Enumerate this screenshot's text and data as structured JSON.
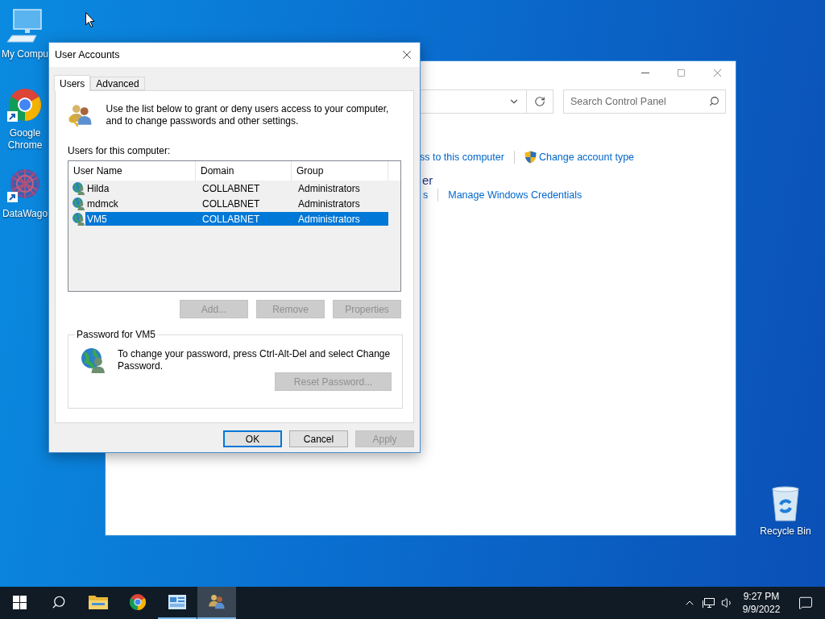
{
  "desktop_icons": [
    {
      "kind": "computer",
      "label": "My Compu"
    },
    {
      "kind": "chrome",
      "label": "Google Chrome"
    },
    {
      "kind": "datawagon",
      "label": "DataWago"
    },
    {
      "kind": "recycle",
      "label": "Recycle Bin"
    }
  ],
  "control_panel": {
    "search": {
      "placeholder": "Search Control Panel"
    },
    "links_row_1": [
      "ss to this computer",
      "Change account type"
    ],
    "heading": "er",
    "links_row_2": [
      "s",
      "Manage Windows Credentials"
    ]
  },
  "dialog": {
    "title": "User Accounts",
    "tabs": [
      {
        "label": "Users",
        "selected": true
      },
      {
        "label": "Advanced",
        "selected": false
      }
    ],
    "intro": "Use the list below to grant or deny users access to your computer, and to change passwords and other settings.",
    "users_label": "Users for this computer:",
    "columns": [
      "User Name",
      "Domain",
      "Group"
    ],
    "rows": [
      {
        "cells": [
          "Hilda",
          "COLLABNET",
          "Administrators"
        ],
        "selected": false
      },
      {
        "cells": [
          "mdmck",
          "COLLABNET",
          "Administrators"
        ],
        "selected": false
      },
      {
        "cells": [
          "VM5",
          "COLLABNET",
          "Administrators"
        ],
        "selected": true
      }
    ],
    "list_buttons": [
      {
        "label": "Add...",
        "disabled": true
      },
      {
        "label": "Remove",
        "disabled": true
      },
      {
        "label": "Properties",
        "disabled": true
      }
    ],
    "password_group": {
      "title": "Password for VM5",
      "text": "To change your password, press Ctrl-Alt-Del and select Change Password.",
      "button": {
        "label": "Reset Password...",
        "disabled": true
      }
    },
    "footer_buttons": [
      {
        "label": "OK",
        "disabled": false,
        "default": true
      },
      {
        "label": "Cancel",
        "disabled": false,
        "default": false
      },
      {
        "label": "Apply",
        "disabled": true,
        "default": false
      }
    ]
  },
  "taskbar": {
    "apps": [
      {
        "kind": "start",
        "running": false,
        "active": false
      },
      {
        "kind": "search",
        "running": false,
        "active": false
      },
      {
        "kind": "explorer",
        "running": false,
        "active": false
      },
      {
        "kind": "chrome",
        "running": false,
        "active": false
      },
      {
        "kind": "control-panel",
        "running": true,
        "active": false
      },
      {
        "kind": "users",
        "running": true,
        "active": true
      }
    ],
    "time": "9:27 PM",
    "date": "9/9/2022"
  }
}
